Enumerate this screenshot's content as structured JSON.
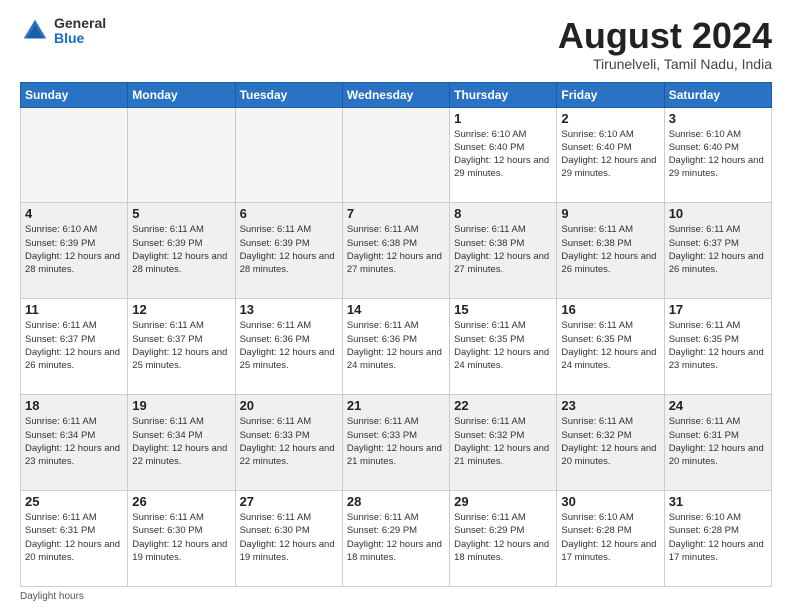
{
  "logo": {
    "general": "General",
    "blue": "Blue"
  },
  "title": "August 2024",
  "location": "Tirunelveli, Tamil Nadu, India",
  "days_of_week": [
    "Sunday",
    "Monday",
    "Tuesday",
    "Wednesday",
    "Thursday",
    "Friday",
    "Saturday"
  ],
  "footer": "Daylight hours",
  "weeks": [
    [
      {
        "day": "",
        "info": "",
        "empty": true
      },
      {
        "day": "",
        "info": "",
        "empty": true
      },
      {
        "day": "",
        "info": "",
        "empty": true
      },
      {
        "day": "",
        "info": "",
        "empty": true
      },
      {
        "day": "1",
        "info": "Sunrise: 6:10 AM\nSunset: 6:40 PM\nDaylight: 12 hours\nand 29 minutes."
      },
      {
        "day": "2",
        "info": "Sunrise: 6:10 AM\nSunset: 6:40 PM\nDaylight: 12 hours\nand 29 minutes."
      },
      {
        "day": "3",
        "info": "Sunrise: 6:10 AM\nSunset: 6:40 PM\nDaylight: 12 hours\nand 29 minutes."
      }
    ],
    [
      {
        "day": "4",
        "info": "Sunrise: 6:10 AM\nSunset: 6:39 PM\nDaylight: 12 hours\nand 28 minutes.",
        "shaded": true
      },
      {
        "day": "5",
        "info": "Sunrise: 6:11 AM\nSunset: 6:39 PM\nDaylight: 12 hours\nand 28 minutes.",
        "shaded": true
      },
      {
        "day": "6",
        "info": "Sunrise: 6:11 AM\nSunset: 6:39 PM\nDaylight: 12 hours\nand 28 minutes.",
        "shaded": true
      },
      {
        "day": "7",
        "info": "Sunrise: 6:11 AM\nSunset: 6:38 PM\nDaylight: 12 hours\nand 27 minutes.",
        "shaded": true
      },
      {
        "day": "8",
        "info": "Sunrise: 6:11 AM\nSunset: 6:38 PM\nDaylight: 12 hours\nand 27 minutes.",
        "shaded": true
      },
      {
        "day": "9",
        "info": "Sunrise: 6:11 AM\nSunset: 6:38 PM\nDaylight: 12 hours\nand 26 minutes.",
        "shaded": true
      },
      {
        "day": "10",
        "info": "Sunrise: 6:11 AM\nSunset: 6:37 PM\nDaylight: 12 hours\nand 26 minutes.",
        "shaded": true
      }
    ],
    [
      {
        "day": "11",
        "info": "Sunrise: 6:11 AM\nSunset: 6:37 PM\nDaylight: 12 hours\nand 26 minutes."
      },
      {
        "day": "12",
        "info": "Sunrise: 6:11 AM\nSunset: 6:37 PM\nDaylight: 12 hours\nand 25 minutes."
      },
      {
        "day": "13",
        "info": "Sunrise: 6:11 AM\nSunset: 6:36 PM\nDaylight: 12 hours\nand 25 minutes."
      },
      {
        "day": "14",
        "info": "Sunrise: 6:11 AM\nSunset: 6:36 PM\nDaylight: 12 hours\nand 24 minutes."
      },
      {
        "day": "15",
        "info": "Sunrise: 6:11 AM\nSunset: 6:35 PM\nDaylight: 12 hours\nand 24 minutes."
      },
      {
        "day": "16",
        "info": "Sunrise: 6:11 AM\nSunset: 6:35 PM\nDaylight: 12 hours\nand 24 minutes."
      },
      {
        "day": "17",
        "info": "Sunrise: 6:11 AM\nSunset: 6:35 PM\nDaylight: 12 hours\nand 23 minutes."
      }
    ],
    [
      {
        "day": "18",
        "info": "Sunrise: 6:11 AM\nSunset: 6:34 PM\nDaylight: 12 hours\nand 23 minutes.",
        "shaded": true
      },
      {
        "day": "19",
        "info": "Sunrise: 6:11 AM\nSunset: 6:34 PM\nDaylight: 12 hours\nand 22 minutes.",
        "shaded": true
      },
      {
        "day": "20",
        "info": "Sunrise: 6:11 AM\nSunset: 6:33 PM\nDaylight: 12 hours\nand 22 minutes.",
        "shaded": true
      },
      {
        "day": "21",
        "info": "Sunrise: 6:11 AM\nSunset: 6:33 PM\nDaylight: 12 hours\nand 21 minutes.",
        "shaded": true
      },
      {
        "day": "22",
        "info": "Sunrise: 6:11 AM\nSunset: 6:32 PM\nDaylight: 12 hours\nand 21 minutes.",
        "shaded": true
      },
      {
        "day": "23",
        "info": "Sunrise: 6:11 AM\nSunset: 6:32 PM\nDaylight: 12 hours\nand 20 minutes.",
        "shaded": true
      },
      {
        "day": "24",
        "info": "Sunrise: 6:11 AM\nSunset: 6:31 PM\nDaylight: 12 hours\nand 20 minutes.",
        "shaded": true
      }
    ],
    [
      {
        "day": "25",
        "info": "Sunrise: 6:11 AM\nSunset: 6:31 PM\nDaylight: 12 hours\nand 20 minutes."
      },
      {
        "day": "26",
        "info": "Sunrise: 6:11 AM\nSunset: 6:30 PM\nDaylight: 12 hours\nand 19 minutes."
      },
      {
        "day": "27",
        "info": "Sunrise: 6:11 AM\nSunset: 6:30 PM\nDaylight: 12 hours\nand 19 minutes."
      },
      {
        "day": "28",
        "info": "Sunrise: 6:11 AM\nSunset: 6:29 PM\nDaylight: 12 hours\nand 18 minutes."
      },
      {
        "day": "29",
        "info": "Sunrise: 6:11 AM\nSunset: 6:29 PM\nDaylight: 12 hours\nand 18 minutes."
      },
      {
        "day": "30",
        "info": "Sunrise: 6:10 AM\nSunset: 6:28 PM\nDaylight: 12 hours\nand 17 minutes."
      },
      {
        "day": "31",
        "info": "Sunrise: 6:10 AM\nSunset: 6:28 PM\nDaylight: 12 hours\nand 17 minutes."
      }
    ]
  ]
}
